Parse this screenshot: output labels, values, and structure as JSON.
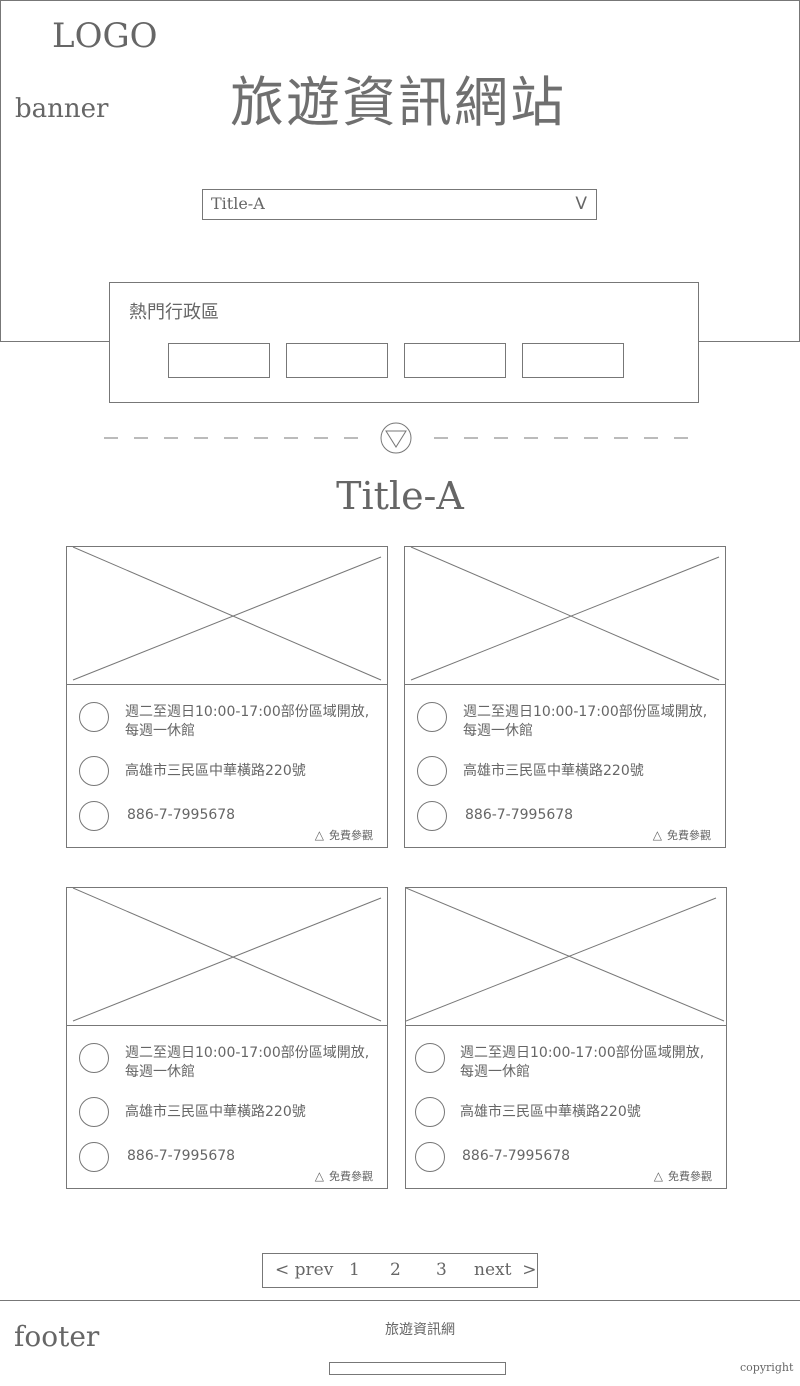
{
  "header": {
    "logo": "LOGO",
    "banner_label": "banner",
    "site_title": "旅遊資訊網站",
    "select": {
      "value": "Title-A",
      "chevron": "V"
    }
  },
  "districts": {
    "label": "熱門行政區"
  },
  "divider_icon": "down-triangle-circle-icon",
  "section": {
    "title": "Title-A"
  },
  "cards": [
    {
      "hours": "週二至週日10:00-17:00部份區域開放,",
      "hours2": "每週一休館",
      "address": "高雄市三民區中華橫路220號",
      "phone": "886-7-7995678",
      "tag": "免費參觀"
    },
    {
      "hours": "週二至週日10:00-17:00部份區域開放,",
      "hours2": "每週一休館",
      "address": "高雄市三民區中華橫路220號",
      "phone": "886-7-7995678",
      "tag": "免費參觀"
    },
    {
      "hours": "週二至週日10:00-17:00部份區域開放,",
      "hours2": "每週一休館",
      "address": "高雄市三民區中華橫路220號",
      "phone": "886-7-7995678",
      "tag": "免費參觀"
    },
    {
      "hours": "週二至週日10:00-17:00部份區域開放,",
      "hours2": "每週一休館",
      "address": "高雄市三民區中華橫路220號",
      "phone": "886-7-7995678",
      "tag": "免費參觀"
    }
  ],
  "pagination": {
    "prev": "< prev",
    "pages": [
      "1",
      "2",
      "3"
    ],
    "next": "next  >"
  },
  "footer": {
    "label": "footer",
    "site_name": "旅遊資訊網",
    "copyright": "copyright"
  }
}
